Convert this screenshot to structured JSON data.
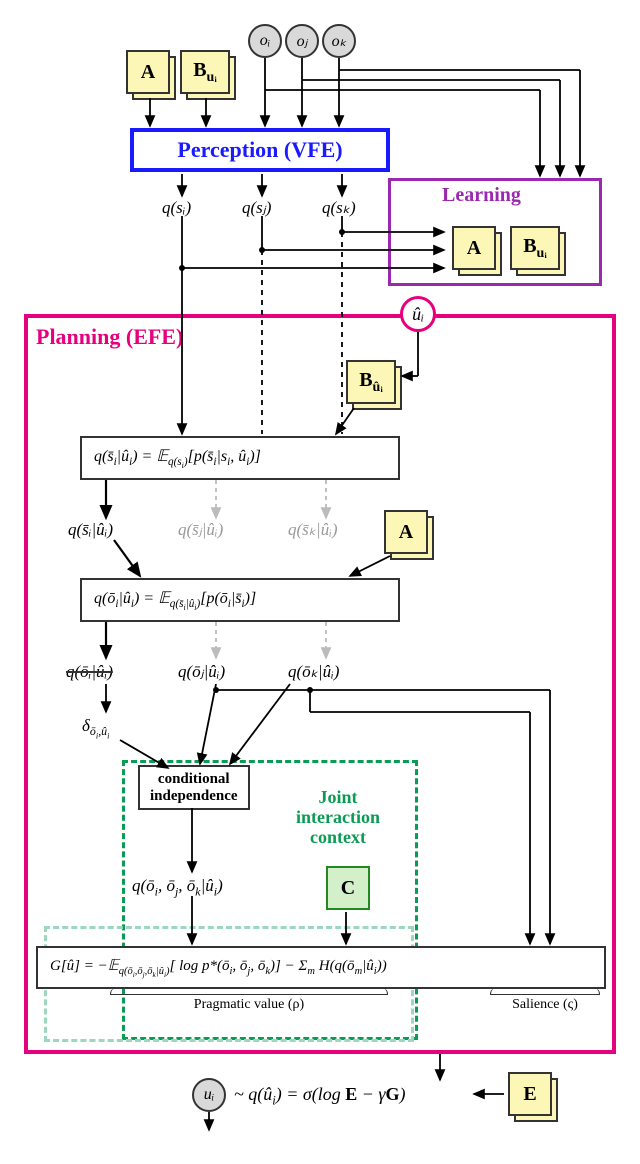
{
  "observations": {
    "oi": "oᵢ",
    "oj": "oⱼ",
    "ok": "oₖ"
  },
  "matrices": {
    "A": "A",
    "Bui": "B",
    "Bui_sub": "uᵢ",
    "Buhat": "B",
    "Buhat_sub": "ûᵢ",
    "C": "C",
    "E": "E"
  },
  "blocks": {
    "perception": "Perception (VFE)",
    "learning": "Learning",
    "planning": "Planning (EFE)",
    "joint_ctx1": "Joint",
    "joint_ctx2": "interaction",
    "joint_ctx3": "context",
    "cond_indep1": "conditional",
    "cond_indep2": "independence"
  },
  "qs": {
    "qsi": "q(sᵢ)",
    "qsj": "q(sⱼ)",
    "qsk": "q(sₖ)"
  },
  "uhat": "ûᵢ",
  "eq_state_pred": "q(s̄ᵢ|ûᵢ) = 𝔼_q(sᵢ)[p(s̄ᵢ|sᵢ, ûᵢ)]",
  "qsbar": {
    "i": "q(s̄ᵢ|ûᵢ)",
    "j": "q(s̄ⱼ|ûᵢ)",
    "k": "q(s̄ₖ|ûᵢ)"
  },
  "eq_obs_pred": "q(ōᵢ|ûᵢ) = 𝔼_q(s̄ᵢ|ûᵢ)[p(ōᵢ|s̄ᵢ)]",
  "qobar": {
    "i": "q(ōᵢ|ûᵢ)",
    "j": "q(ōⱼ|ûᵢ)",
    "k": "q(ōₖ|ûᵢ)"
  },
  "delta": "δ_ōᵢ,ûᵢ",
  "qjoint": "q(ōᵢ, ōⱼ, ōₖ|ûᵢ)",
  "eq_G": "G[û] = −𝔼_q(ōᵢ,ōⱼ,ōₖ|ûᵢ)[log p*(ōᵢ, ōⱼ, ōₖ)] − Σₘ H(q(ōₘ|ûᵢ))",
  "ubrace_prag": "Pragmatic value (ρ)",
  "ubrace_sal": "Salience (ς)",
  "ui_out": "uᵢ",
  "eq_action": "~ q(ûᵢ) = σ(log E − γG)"
}
